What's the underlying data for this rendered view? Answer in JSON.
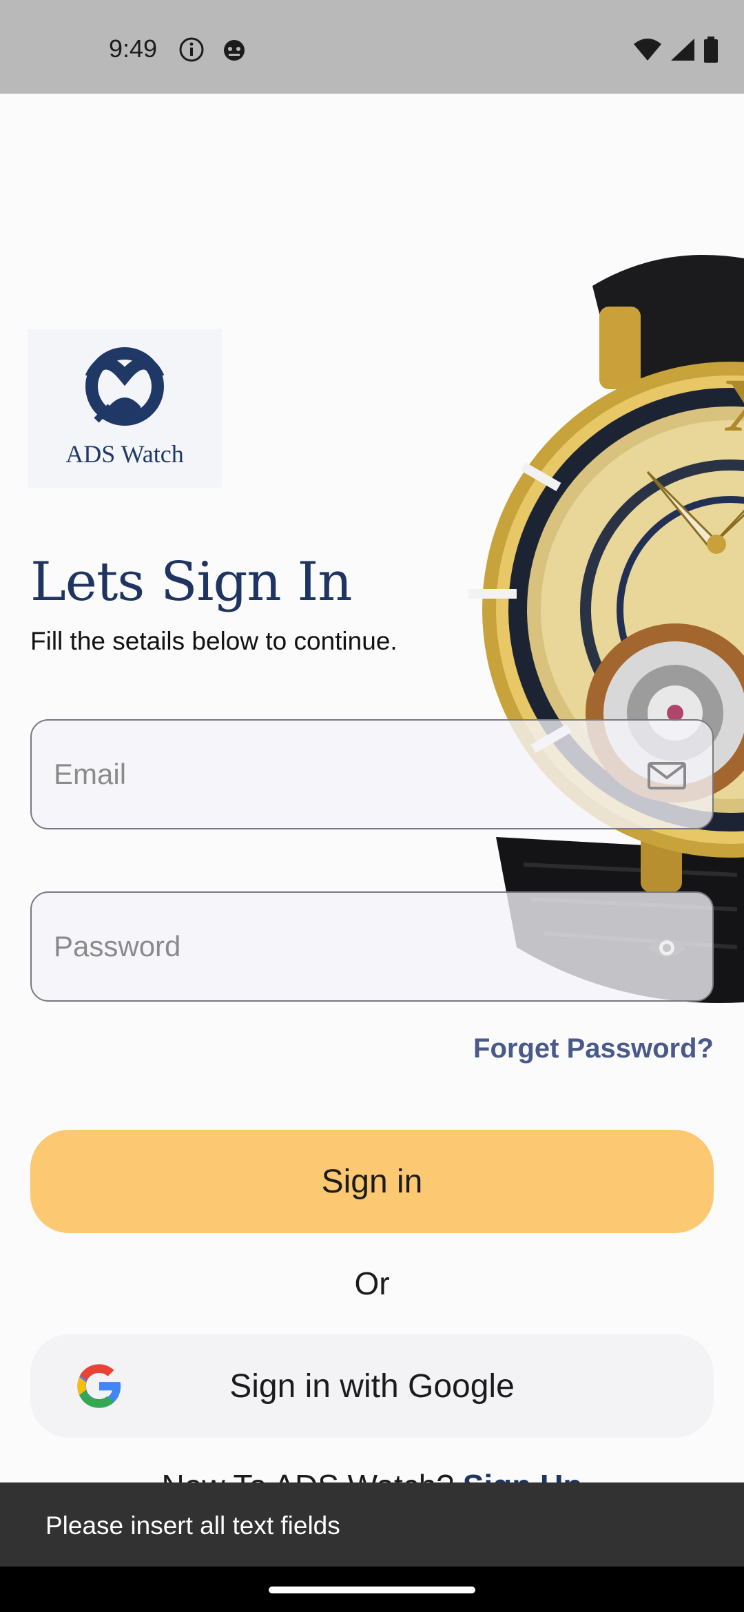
{
  "status_bar": {
    "time": "9:49",
    "left_icons": [
      "info-icon",
      "debug-icon"
    ],
    "right_icons": [
      "wifi-icon",
      "signal-icon",
      "battery-icon"
    ]
  },
  "logo": {
    "text": "ADS Watch",
    "color": "#1f3866"
  },
  "heading": "Lets Sign In",
  "subheading": "Fill the setails below to continue.",
  "form": {
    "email": {
      "placeholder": "Email",
      "value": "",
      "icon": "mail-icon"
    },
    "password": {
      "placeholder": "Password",
      "value": "",
      "icon": "eye-icon"
    },
    "forgot_label": "Forget Password?"
  },
  "actions": {
    "signin_label": "Sign in",
    "or_label": "Or",
    "google_label": "Sign in with Google"
  },
  "signup": {
    "prompt": "New To ADS Watch?",
    "link": "Sign Up"
  },
  "snackbar": {
    "message": "Please insert all text fields"
  },
  "colors": {
    "accent": "#fcc872",
    "brand": "#1f3460",
    "link": "#48598a",
    "snackbar": "#323232",
    "status_bar": "#b9b9b9"
  }
}
